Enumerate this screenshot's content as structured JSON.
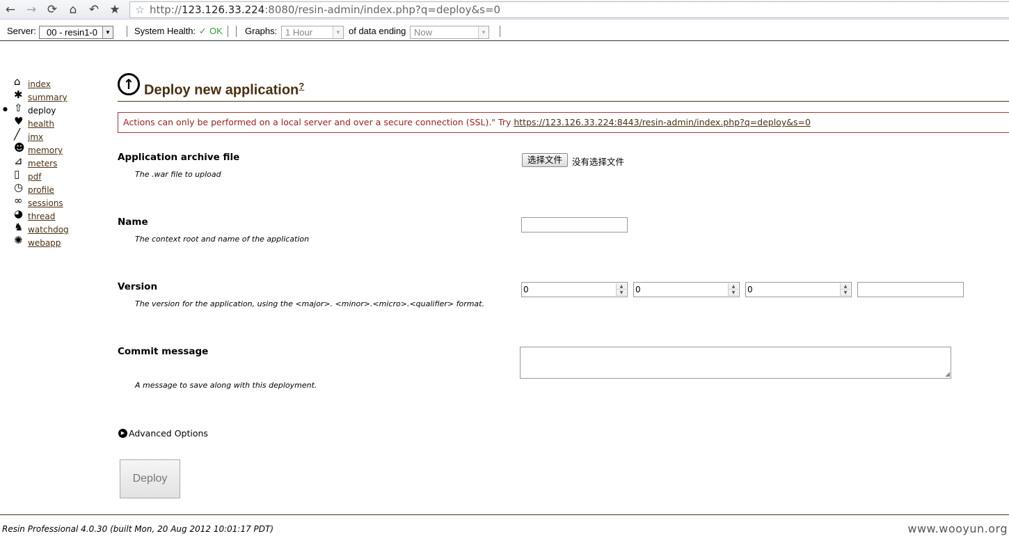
{
  "browser": {
    "url_prefix": "http://",
    "url_host": "123.126.33.224",
    "url_rest": ":8080/resin-admin/index.php?q=deploy&s=0",
    "nav_icons": [
      "back-icon",
      "forward-icon",
      "reload-icon",
      "home-icon",
      "undo-icon",
      "bookmark-star-icon"
    ]
  },
  "toolbar": {
    "server_label": "Server:",
    "server_value": "00 - resin1-0",
    "health_label": "System Health:",
    "health_check": "✓",
    "health_value": "OK",
    "graphs_label": "Graphs:",
    "graphs_value": "1 Hour",
    "ending_label": "of data ending",
    "ending_value": "Now"
  },
  "sidebar": {
    "items": [
      {
        "label": "index",
        "icon": "house-icon",
        "glyph": "⌂"
      },
      {
        "label": "summary",
        "icon": "summary-icon",
        "glyph": "✱"
      },
      {
        "label": "deploy",
        "icon": "deploy-upload-icon",
        "glyph": "⇧",
        "current": true
      },
      {
        "label": "health",
        "icon": "heart-icon",
        "glyph": "♥"
      },
      {
        "label": "jmx",
        "icon": "wrench-icon",
        "glyph": "╱"
      },
      {
        "label": "memory",
        "icon": "memory-head-icon",
        "glyph": "☻"
      },
      {
        "label": "meters",
        "icon": "meter-graph-icon",
        "glyph": "⊿"
      },
      {
        "label": "pdf",
        "icon": "document-icon",
        "glyph": "▯"
      },
      {
        "label": "profile",
        "icon": "stopwatch-icon",
        "glyph": "◷"
      },
      {
        "label": "sessions",
        "icon": "link-icon",
        "glyph": "∞"
      },
      {
        "label": "thread",
        "icon": "thread-spool-icon",
        "glyph": "◕"
      },
      {
        "label": "watchdog",
        "icon": "dog-icon",
        "glyph": "♞"
      },
      {
        "label": "webapp",
        "icon": "web-icon",
        "glyph": "✺"
      }
    ]
  },
  "main": {
    "title": "Deploy new application",
    "title_help": "?",
    "alert_text": "Actions can only be performed on a local server and over a secure connection (SSL).\" Try ",
    "alert_link": "https://123.126.33.224:8443/resin-admin/index.php?q=deploy&s=0",
    "fields": {
      "archive": {
        "label": "Application archive file",
        "desc": "The .war file to upload",
        "button": "选择文件",
        "status": "没有选择文件"
      },
      "name": {
        "label": "Name",
        "desc": "The context root and name of the application",
        "value": ""
      },
      "version": {
        "label": "Version",
        "desc": "The version for the application, using the <major>. <minor>.<micro>.<qualifier> format.",
        "major": "0",
        "minor": "0",
        "micro": "0",
        "qualifier": ""
      },
      "commit": {
        "label": "Commit message",
        "desc": "A message to save along with this deployment.",
        "value": ""
      }
    },
    "advanced_label": "Advanced Options",
    "deploy_button": "Deploy"
  },
  "footer": {
    "version_text": "Resin Professional 4.0.30 (built Mon, 20 Aug 2012 10:01:17 PDT)",
    "watermark": "www.wooyun.org"
  }
}
